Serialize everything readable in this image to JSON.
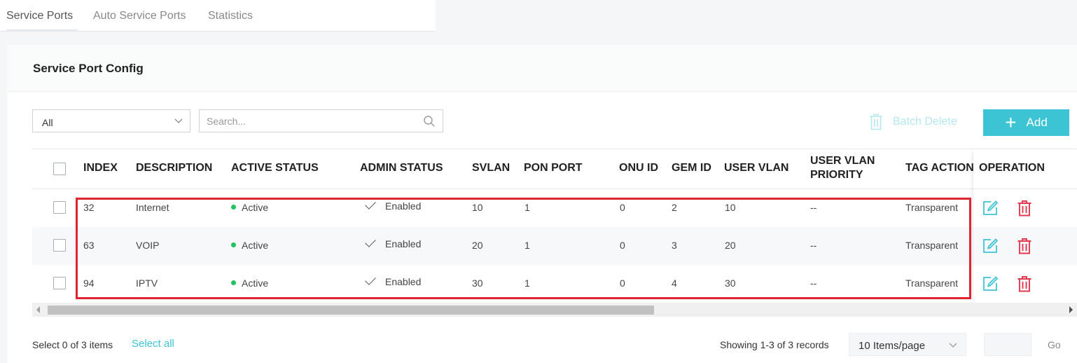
{
  "tabs": [
    {
      "label": "Service Ports",
      "active": true
    },
    {
      "label": "Auto Service Ports",
      "active": false
    },
    {
      "label": "Statistics",
      "active": false
    }
  ],
  "card": {
    "title": "Service Port Config"
  },
  "toolbar": {
    "filter_value": "All",
    "search_placeholder": "Search...",
    "batch_delete_label": "Batch Delete",
    "add_label": "Add"
  },
  "table": {
    "headers": {
      "index": "INDEX",
      "description": "DESCRIPTION",
      "active_status": "ACTIVE STATUS",
      "admin_status": "ADMIN STATUS",
      "svlan": "SVLAN",
      "pon_port": "PON PORT",
      "onu_id": "ONU ID",
      "gem_id": "GEM ID",
      "user_vlan": "USER VLAN",
      "user_vlan_priority_1": "USER VLAN",
      "user_vlan_priority_2": "PRIORITY",
      "tag_action": "TAG ACTION",
      "operation": "OPERATION"
    },
    "rows": [
      {
        "index": "32",
        "description": "Internet",
        "active_status": "Active",
        "admin_status": "Enabled",
        "svlan": "10",
        "pon_port": "1",
        "onu_id": "0",
        "gem_id": "2",
        "user_vlan": "10",
        "user_vlan_priority": "--",
        "tag_action": "Transparent"
      },
      {
        "index": "63",
        "description": "VOIP",
        "active_status": "Active",
        "admin_status": "Enabled",
        "svlan": "20",
        "pon_port": "1",
        "onu_id": "0",
        "gem_id": "3",
        "user_vlan": "20",
        "user_vlan_priority": "--",
        "tag_action": "Transparent"
      },
      {
        "index": "94",
        "description": "IPTV",
        "active_status": "Active",
        "admin_status": "Enabled",
        "svlan": "30",
        "pon_port": "1",
        "onu_id": "0",
        "gem_id": "4",
        "user_vlan": "30",
        "user_vlan_priority": "--",
        "tag_action": "Transparent"
      }
    ]
  },
  "footer": {
    "selection": "Select 0 of 3 items",
    "select_all": "Select all",
    "showing": "Showing 1-3 of 3 records",
    "per_page": "10 Items/page",
    "go": "Go"
  },
  "colors": {
    "accent": "#3cc4d5",
    "active_dot": "#22c35e",
    "delete_icon": "#e4384f",
    "highlight": "#e0242f"
  },
  "icons": {
    "edit": "edit-icon",
    "delete": "trash-icon",
    "search": "search-icon",
    "dropdown": "chevron-down-icon"
  }
}
